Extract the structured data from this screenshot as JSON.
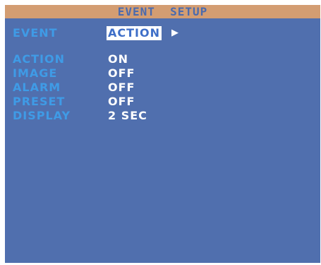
{
  "title": "EVENT  SETUP",
  "colors": {
    "screen_bg": "#506fae",
    "title_bg": "#d39d72",
    "title_fg": "#4a6aae",
    "label_fg": "#3f9be6",
    "value_fg": "#ffffff",
    "highlight_fg": "#3f6fc8"
  },
  "event": {
    "label": "EVENT",
    "value": "ACTION",
    "arrow_icon": "▶"
  },
  "settings": [
    {
      "label": "ACTION",
      "value": "ON"
    },
    {
      "label": "IMAGE",
      "value": "OFF"
    },
    {
      "label": "ALARM",
      "value": "OFF"
    },
    {
      "label": "PRESET",
      "value": "OFF"
    },
    {
      "label": "DISPLAY",
      "value": "2 SEC"
    }
  ]
}
